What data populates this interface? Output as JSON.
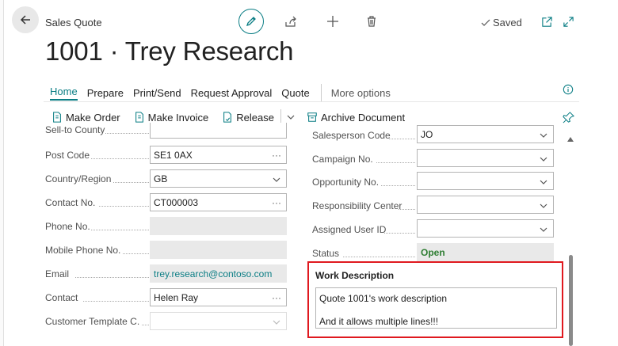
{
  "header": {
    "caption": "Sales Quote",
    "title": "1001 · Trey Research",
    "saved": "Saved"
  },
  "menu": {
    "items": [
      "Home",
      "Prepare",
      "Print/Send",
      "Request Approval",
      "Quote"
    ],
    "more": "More options"
  },
  "actions": {
    "make_order": "Make Order",
    "make_invoice": "Make Invoice",
    "release": "Release",
    "archive": "Archive Document"
  },
  "left_fields": {
    "sell_to_county": {
      "label": "Sell-to County",
      "value": ""
    },
    "post_code": {
      "label": "Post Code",
      "value": "SE1 0AX"
    },
    "country_region": {
      "label": "Country/Region",
      "value": "GB"
    },
    "contact_no": {
      "label": "Contact No.",
      "value": "CT000003"
    },
    "phone_no": {
      "label": "Phone No.",
      "value": ""
    },
    "mobile_phone_no": {
      "label": "Mobile Phone No.",
      "value": ""
    },
    "email": {
      "label": "Email",
      "value": "trey.research@contoso.com"
    },
    "contact": {
      "label": "Contact",
      "value": "Helen Ray"
    },
    "customer_template": {
      "label": "Customer Template C...",
      "value": ""
    }
  },
  "right_fields": {
    "salesperson_code": {
      "label": "Salesperson Code",
      "value": "JO"
    },
    "campaign_no": {
      "label": "Campaign No.",
      "value": ""
    },
    "opportunity_no": {
      "label": "Opportunity No.",
      "value": ""
    },
    "responsibility_center": {
      "label": "Responsibility Center",
      "value": ""
    },
    "assigned_user_id": {
      "label": "Assigned User ID",
      "value": ""
    },
    "status": {
      "label": "Status",
      "value": "Open"
    }
  },
  "work_description": {
    "label": "Work Description",
    "line1": "Quote 1001's work description",
    "line2": "And it allows multiple lines!!!"
  },
  "colors": {
    "accent": "#0a7d84",
    "highlight": "#e0191f",
    "status_open": "#2e7d32"
  }
}
